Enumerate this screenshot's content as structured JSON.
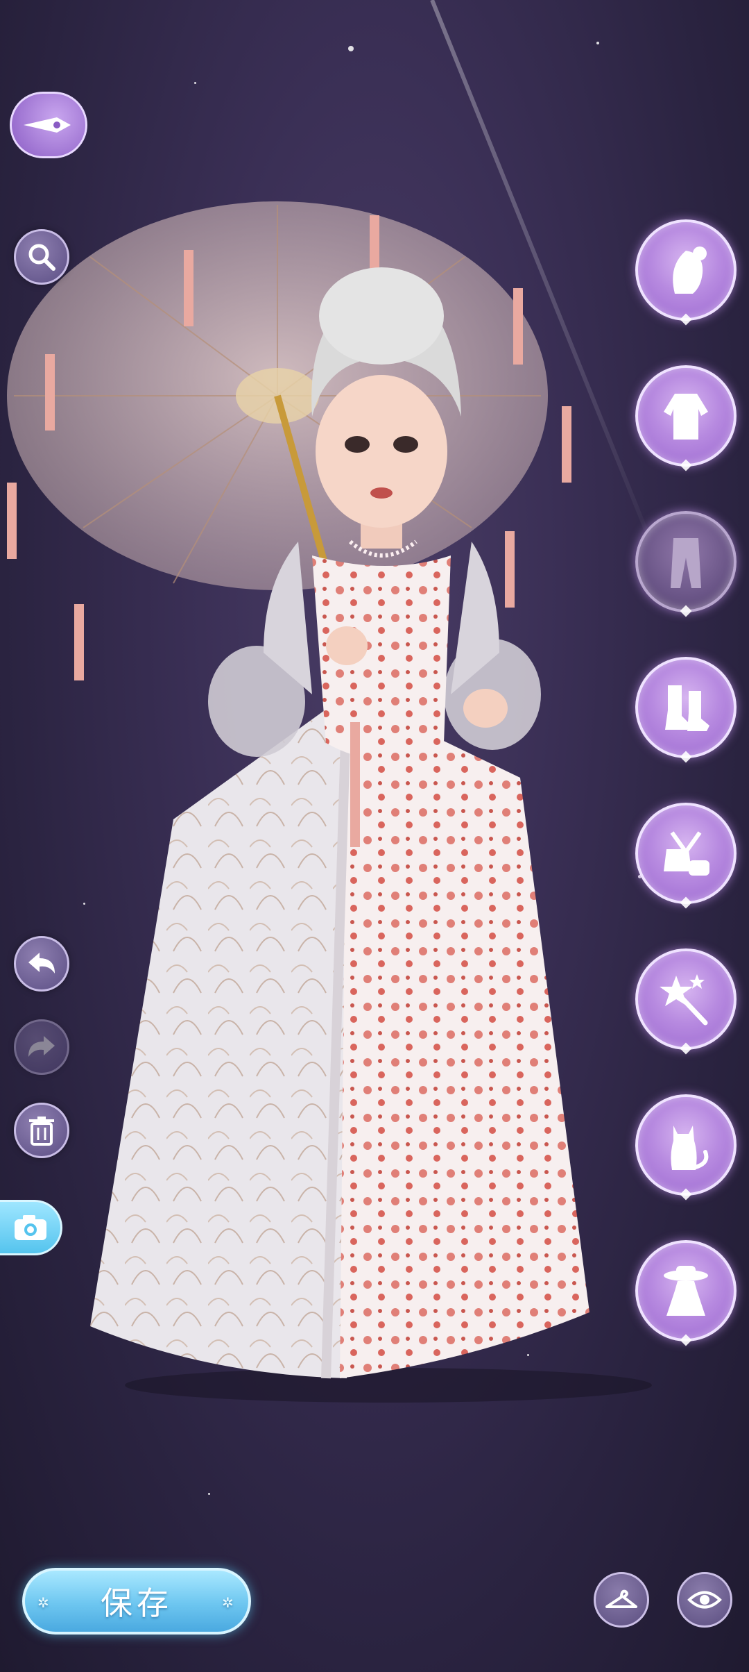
{
  "top_bar": {
    "pen_icon": "fountain-pen-icon"
  },
  "left_tools": [
    {
      "name": "search",
      "icon": "magnifier-icon",
      "enabled": true
    },
    {
      "name": "undo",
      "icon": "undo-arrow-icon",
      "enabled": true
    },
    {
      "name": "redo",
      "icon": "redo-arrow-icon",
      "enabled": false
    },
    {
      "name": "delete",
      "icon": "trash-icon",
      "enabled": true
    }
  ],
  "camera": {
    "icon": "camera-icon"
  },
  "categories": [
    {
      "name": "hair",
      "icon": "hair-silhouette-icon",
      "active": true
    },
    {
      "name": "tops",
      "icon": "blouse-icon",
      "active": true
    },
    {
      "name": "bottoms",
      "icon": "pants-icon",
      "active": false
    },
    {
      "name": "shoes",
      "icon": "boots-icon",
      "active": true
    },
    {
      "name": "accessories",
      "icon": "necklace-bag-icon",
      "active": true
    },
    {
      "name": "effects",
      "icon": "magic-wand-icon",
      "active": true
    },
    {
      "name": "pets",
      "icon": "cat-icon",
      "active": true
    },
    {
      "name": "outfit",
      "icon": "hat-dress-icon",
      "active": true
    }
  ],
  "save_button": {
    "label": "保存"
  },
  "bottom_right": [
    {
      "name": "wardrobe",
      "icon": "hanger-icon"
    },
    {
      "name": "preview",
      "icon": "eye-icon"
    }
  ],
  "colors": {
    "accent": "#b78ae0",
    "save": "#6dc6f0",
    "background": "#2a2340"
  }
}
